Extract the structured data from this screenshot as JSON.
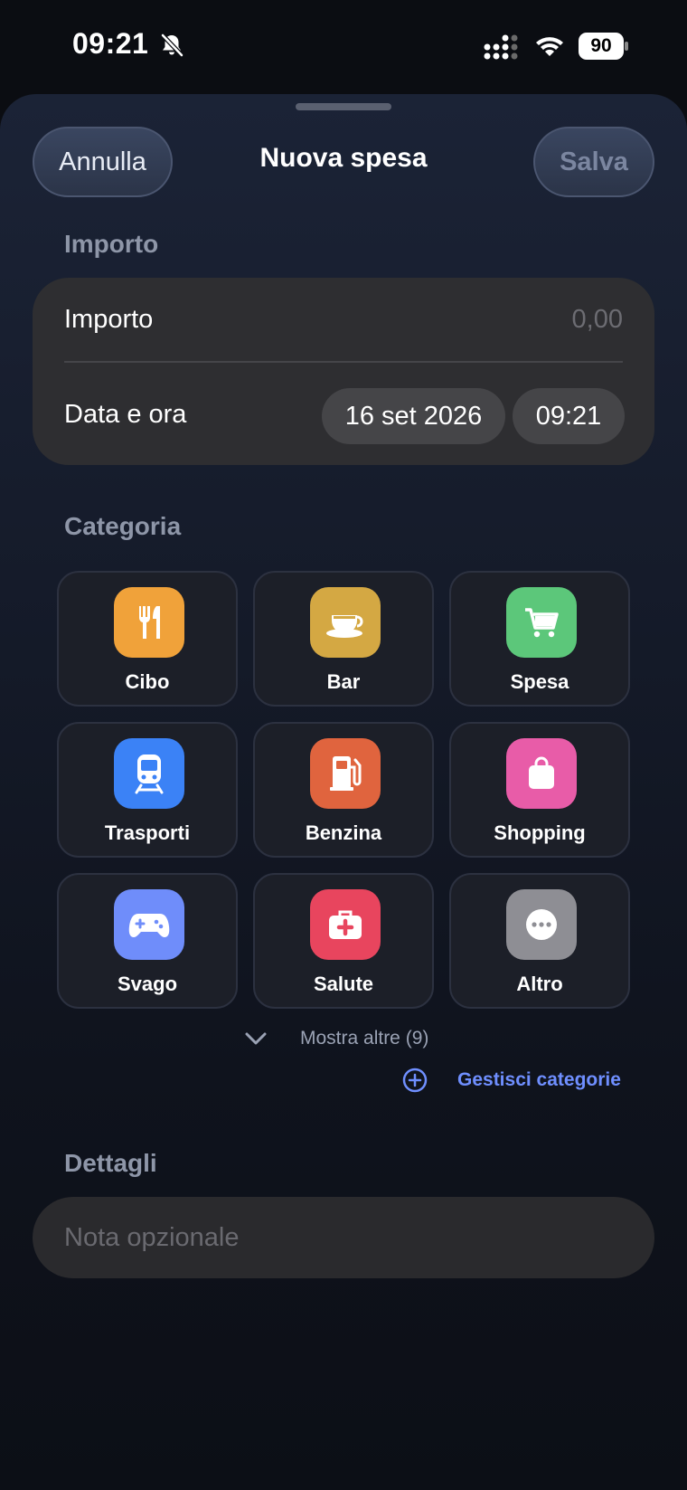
{
  "status_bar": {
    "time": "09:21",
    "battery": "90",
    "icons": [
      "bell-slash-icon",
      "cellular-signal-icon",
      "wifi-icon",
      "battery-icon"
    ]
  },
  "nav": {
    "cancel_label": "Annulla",
    "title": "Nuova spesa",
    "save_label": "Salva"
  },
  "amount_section": {
    "header": "Importo",
    "amount_label": "Importo",
    "amount_placeholder": "0,00",
    "datetime_label": "Data e ora",
    "date_value": "16 set 2026",
    "time_value": "09:21"
  },
  "category_section": {
    "header": "Categoria",
    "categories": [
      {
        "label": "Cibo",
        "icon": "fork-knife-icon",
        "color": "#f0a23a"
      },
      {
        "label": "Bar",
        "icon": "coffee-cup-icon",
        "color": "#d4a843"
      },
      {
        "label": "Spesa",
        "icon": "cart-icon",
        "color": "#5cc77a"
      },
      {
        "label": "Trasporti",
        "icon": "train-icon",
        "color": "#3b82f6"
      },
      {
        "label": "Benzina",
        "icon": "fuel-pump-icon",
        "color": "#e0643e"
      },
      {
        "label": "Shopping",
        "icon": "shopping-bag-icon",
        "color": "#e85ca8"
      },
      {
        "label": "Svago",
        "icon": "gamepad-icon",
        "color": "#6f8dfa"
      },
      {
        "label": "Salute",
        "icon": "medical-kit-icon",
        "color": "#e8455e"
      },
      {
        "label": "Altro",
        "icon": "ellipsis-icon",
        "color": "#8e8e94"
      }
    ],
    "show_more_label": "Mostra altre (9)",
    "manage_label": "Gestisci categorie"
  },
  "details_section": {
    "header": "Dettagli",
    "note_placeholder": "Nota opzionale",
    "note_value": ""
  },
  "colors": {
    "accent": "#6f8fff",
    "card": "#2e2e31",
    "tile": "#1c1f28"
  }
}
